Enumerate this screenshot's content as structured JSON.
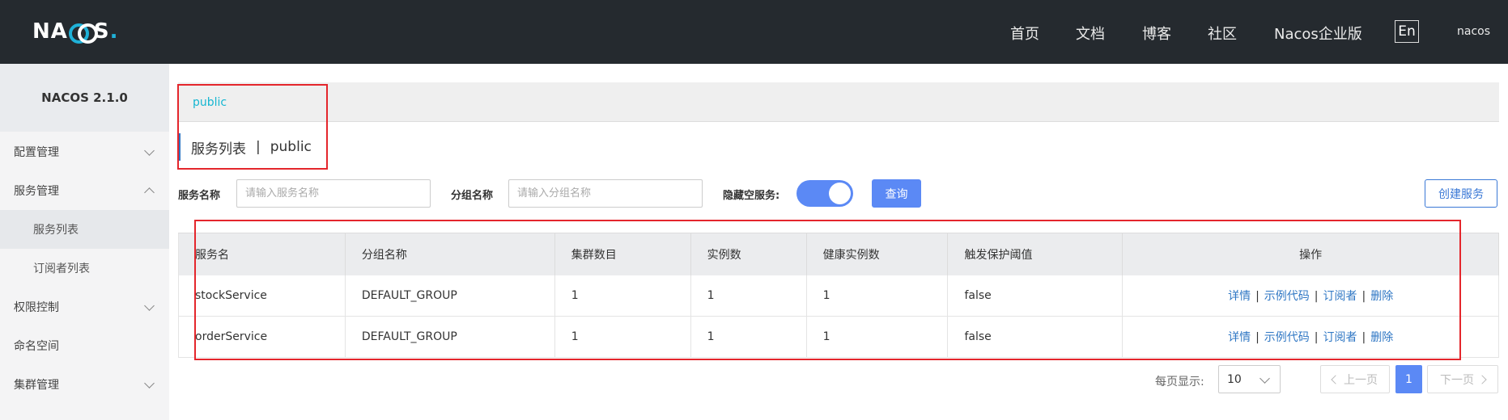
{
  "header": {
    "logo": "NACOS",
    "nav": [
      "首页",
      "文档",
      "博客",
      "社区",
      "Nacos企业版"
    ],
    "lang": "En",
    "user": "nacos"
  },
  "sidebar": {
    "version": "NACOS 2.1.0",
    "items": [
      {
        "label": "配置管理",
        "type": "group",
        "expanded": false
      },
      {
        "label": "服务管理",
        "type": "group",
        "expanded": true
      },
      {
        "label": "服务列表",
        "type": "sub",
        "active": true
      },
      {
        "label": "订阅者列表",
        "type": "sub",
        "active": false
      },
      {
        "label": "权限控制",
        "type": "group",
        "expanded": false
      },
      {
        "label": "命名空间",
        "type": "item"
      },
      {
        "label": "集群管理",
        "type": "group",
        "expanded": false
      }
    ]
  },
  "namespace": {
    "current": "public"
  },
  "title": {
    "main": "服务列表",
    "sep": "|",
    "ns": "public"
  },
  "filters": {
    "service_label": "服务名称",
    "service_placeholder": "请输入服务名称",
    "group_label": "分组名称",
    "group_placeholder": "请输入分组名称",
    "hide_empty_label": "隐藏空服务:",
    "hide_empty_on": true,
    "query_button": "查询",
    "create_button": "创建服务"
  },
  "table": {
    "columns": [
      "服务名",
      "分组名称",
      "集群数目",
      "实例数",
      "健康实例数",
      "触发保护阈值",
      "操作"
    ],
    "rows": [
      [
        "stockService",
        "DEFAULT_GROUP",
        "1",
        "1",
        "1",
        "false"
      ],
      [
        "orderService",
        "DEFAULT_GROUP",
        "1",
        "1",
        "1",
        "false"
      ]
    ],
    "actions": [
      "详情",
      "示例代码",
      "订阅者",
      "删除"
    ]
  },
  "pagination": {
    "per_page_label": "每页显示:",
    "per_page": "10",
    "prev": "上一页",
    "current": "1",
    "next": "下一页"
  },
  "colors": {
    "accent": "#5b89f5",
    "link": "#2f77c4",
    "highlight_box": "#e4262c",
    "topbar": "#252a2f"
  }
}
